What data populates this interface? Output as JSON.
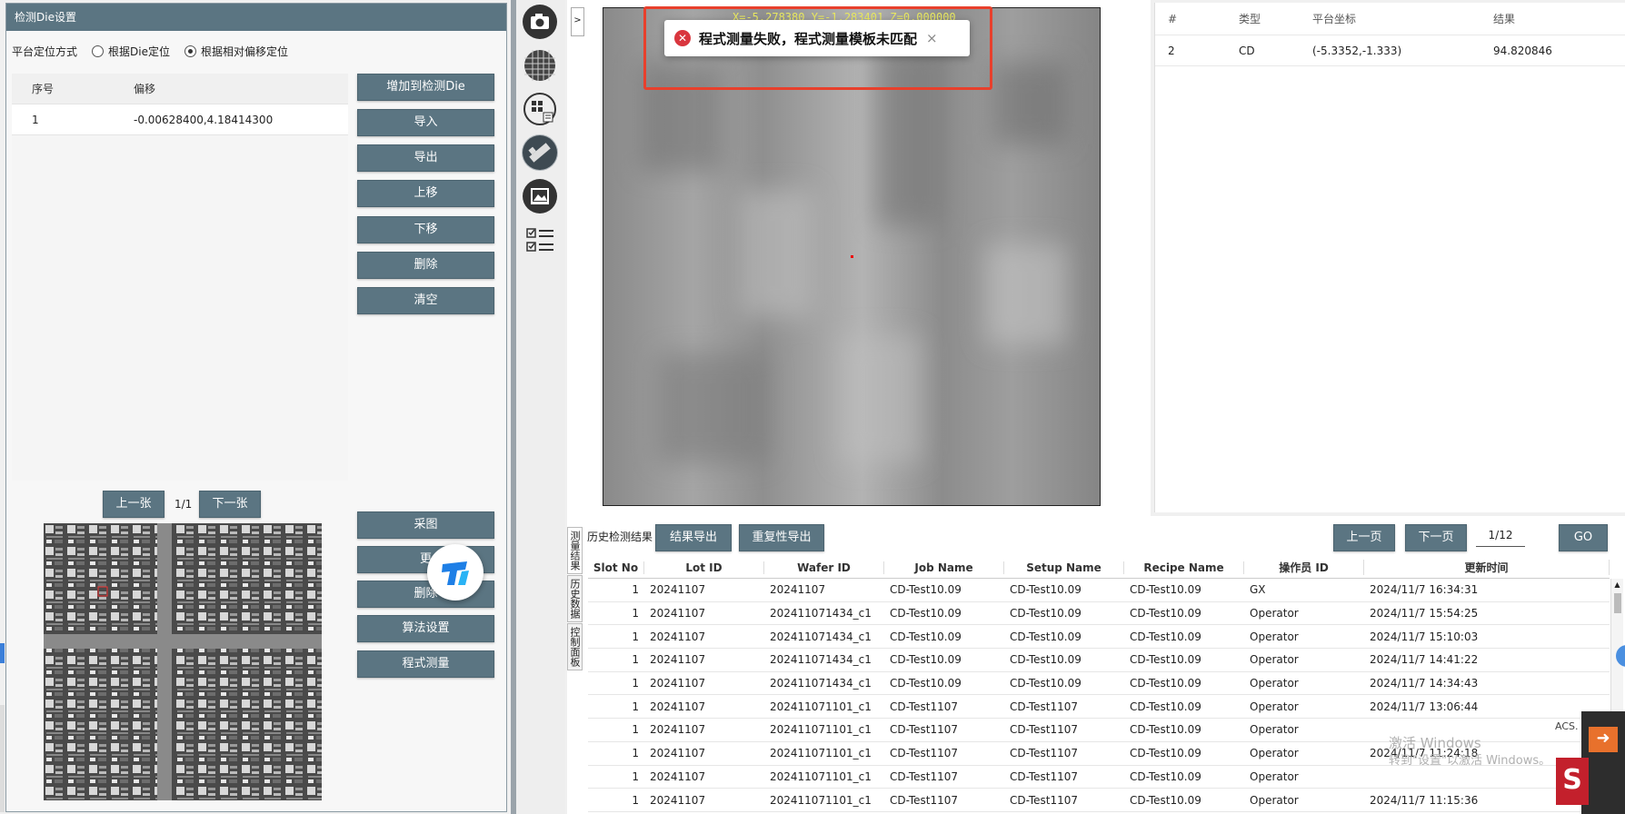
{
  "left": {
    "title": "检测Die设置",
    "locate_label": "平台定位方式",
    "radio_die": "根据Die定位",
    "radio_offset": "根据相对偏移定位",
    "table_headers": [
      "序号",
      "偏移"
    ],
    "table_rows": [
      [
        "1",
        "-0.00628400,4.18414300"
      ]
    ],
    "buttons": [
      "增加到检测Die",
      "导入",
      "导出",
      "上移",
      "下移",
      "删除",
      "清空"
    ],
    "prev_label": "上一张",
    "next_label": "下一张",
    "page_indicator": "1/1",
    "bottom_buttons": [
      "采图",
      "更",
      "删除",
      "算法设置",
      "程式测量"
    ]
  },
  "view": {
    "arrow": ">",
    "coords": "X=-5.278380 Y=-1.283401 Z=0.000000",
    "toast_message": "程式测量失败，程式测量模板未匹配",
    "toast_close": "×"
  },
  "results": {
    "headers": [
      "#",
      "类型",
      "平台坐标",
      "结果"
    ],
    "rows": [
      [
        "2",
        "CD",
        "(-5.3352,-1.333)",
        "94.820846"
      ]
    ]
  },
  "history": {
    "tabs": [
      "测量结果",
      "历史数据",
      "控制面板"
    ],
    "title": "历史检测结果",
    "export_label": "结果导出",
    "repeat_export_label": "重复性导出",
    "prev_page": "上一页",
    "next_page": "下一页",
    "page": "1/12",
    "go": "GO",
    "headers": [
      "Slot No",
      "Lot ID",
      "Wafer ID",
      "Job Name",
      "Setup Name",
      "Recipe Name",
      "操作员 ID",
      "更新时间"
    ],
    "rows": [
      [
        "1",
        "20241107",
        "20241107",
        "CD-Test10.09",
        "CD-Test10.09",
        "CD-Test10.09",
        "GX",
        "2024/11/7 16:34:31"
      ],
      [
        "1",
        "20241107",
        "202411071434_c1",
        "CD-Test10.09",
        "CD-Test10.09",
        "CD-Test10.09",
        "Operator",
        "2024/11/7 15:54:25"
      ],
      [
        "1",
        "20241107",
        "202411071434_c1",
        "CD-Test10.09",
        "CD-Test10.09",
        "CD-Test10.09",
        "Operator",
        "2024/11/7 15:10:03"
      ],
      [
        "1",
        "20241107",
        "202411071434_c1",
        "CD-Test10.09",
        "CD-Test10.09",
        "CD-Test10.09",
        "Operator",
        "2024/11/7 14:41:22"
      ],
      [
        "1",
        "20241107",
        "202411071434_c1",
        "CD-Test10.09",
        "CD-Test10.09",
        "CD-Test10.09",
        "Operator",
        "2024/11/7 14:34:43"
      ],
      [
        "1",
        "20241107",
        "202411071101_c1",
        "CD-Test1107",
        "CD-Test1107",
        "CD-Test10.09",
        "Operator",
        "2024/11/7 13:06:44"
      ],
      [
        "1",
        "20241107",
        "202411071101_c1",
        "CD-Test1107",
        "CD-Test1107",
        "CD-Test10.09",
        "Operator",
        ""
      ],
      [
        "1",
        "20241107",
        "202411071101_c1",
        "CD-Test1107",
        "CD-Test1107",
        "CD-Test10.09",
        "Operator",
        "2024/11/7 11:24:18"
      ],
      [
        "1",
        "20241107",
        "202411071101_c1",
        "CD-Test1107",
        "CD-Test1107",
        "CD-Test10.09",
        "Operator",
        ""
      ],
      [
        "1",
        "20241107",
        "202411071101_c1",
        "CD-Test1107",
        "CD-Test1107",
        "CD-Test10.09",
        "Operator",
        "2024/11/7 11:15:36"
      ]
    ]
  },
  "system": {
    "watermark_line1": "激活 Windows",
    "watermark_line2": "转到\"设置\"以激活 Windows。",
    "acs_label": "ACS.",
    "tray_letter": "S"
  },
  "icons": [
    "camera-icon",
    "wafer-map-icon",
    "die-layout-icon",
    "ruler-icon",
    "image-gallery-icon",
    "checklist-icon",
    "error-icon",
    "close-icon"
  ]
}
